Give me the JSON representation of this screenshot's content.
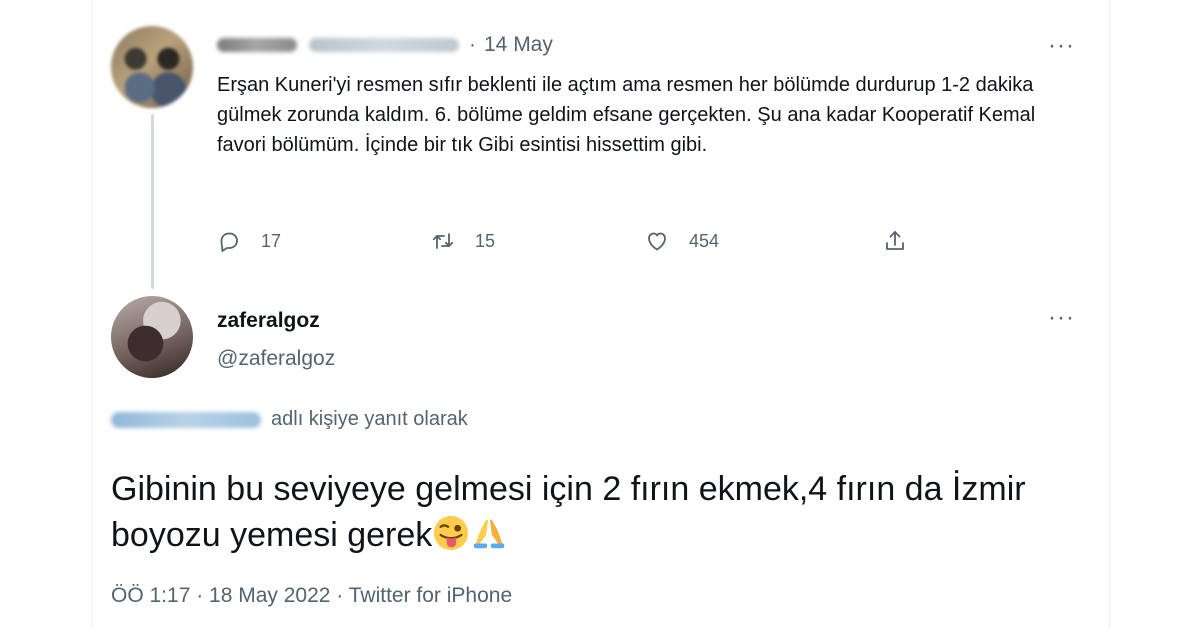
{
  "quoted_tweet": {
    "date": "14 May",
    "separator": "·",
    "more_label": "···",
    "text": "Erşan Kuneri'yi resmen sıfır beklenti ile açtım ama resmen her bölümde durdurup 1-2 dakika gülmek zorunda kaldım. 6. bölüme geldim efsane gerçekten. Şu ana kadar Kooperatif Kemal favori bölümüm. İçinde bir tık Gibi esintisi hissettim gibi.",
    "replies": "17",
    "retweets": "15",
    "likes": "454",
    "icons": [
      "reply-icon",
      "retweet-icon",
      "like-icon",
      "share-icon"
    ]
  },
  "reply_tweet": {
    "display_name": "zaferalgoz",
    "handle": "@zaferalgoz",
    "more_label": "···",
    "reply_context": "adlı kişiye yanıt olarak",
    "text": "Gibinin bu seviyeye gelmesi için 2 fırın ekmek,4 fırın da İzmir boyozu yemesi gerek",
    "emojis": [
      "winking-face-tongue-emoji",
      "folded-hands-emoji"
    ],
    "meta": "ÖÖ 1:17 · 18 May 2022 · Twitter for iPhone"
  },
  "colors": {
    "text_primary": "#0f1419",
    "text_secondary": "#536471",
    "thread_line": "#cfd9de",
    "background": "#ffffff"
  }
}
